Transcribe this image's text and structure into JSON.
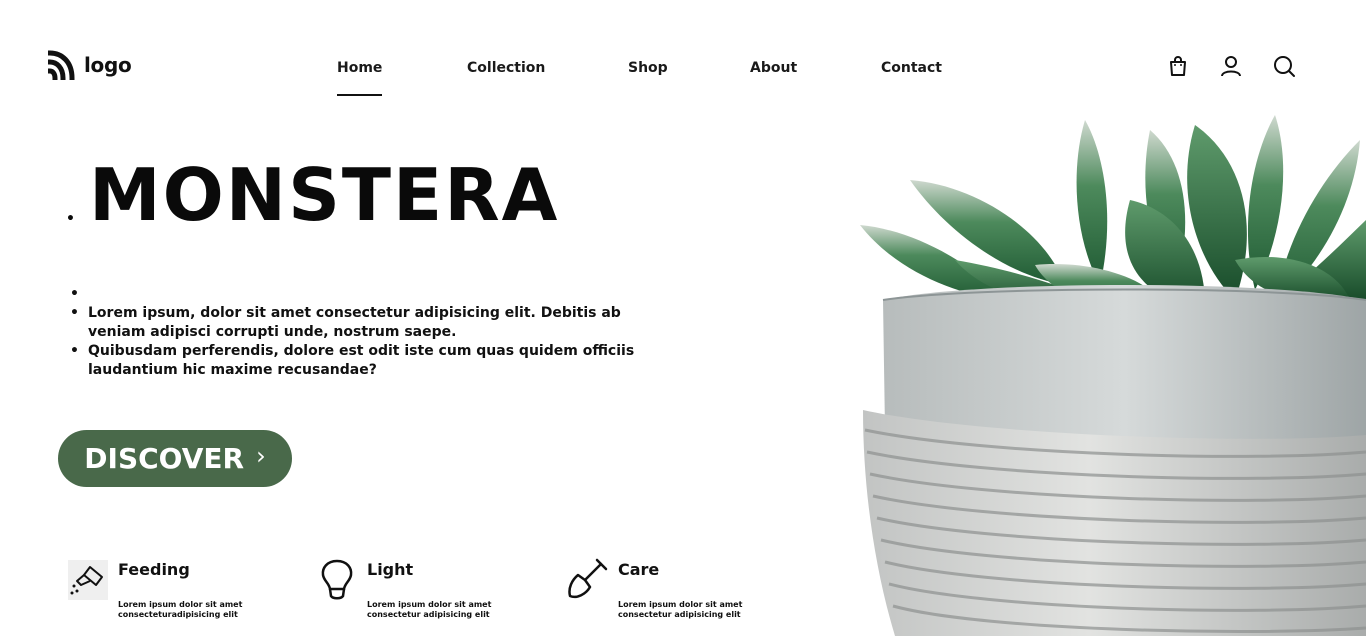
{
  "brand": {
    "logo_text": "logo"
  },
  "nav": {
    "items": [
      {
        "label": "Home",
        "active": true
      },
      {
        "label": "Collection"
      },
      {
        "label": "Shop"
      },
      {
        "label": "About"
      },
      {
        "label": "Contact"
      }
    ]
  },
  "header_icons": [
    "shopping-bag-icon",
    "user-icon",
    "search-icon"
  ],
  "hero": {
    "title": "MONSTERA",
    "bullets": [
      "",
      "Lorem ipsum, dolor sit amet consectetur adipisicing elit. Debitis ab veniam adipisci corrupti unde, nostrum saepe.",
      "Quibusdam perferendis, dolore est odit iste cum quas quidem officiis laudantium hic maxime recusandae?"
    ],
    "cta_label": "DISCOVER",
    "cta_color": "#49694a"
  },
  "features": [
    {
      "title": "Feeding",
      "text": "Lorem ipsum dolor sit amet consecteturadipisicing elit",
      "icon": "watering-can-icon"
    },
    {
      "title": "Light",
      "text": "Lorem ipsum dolor sit amet consectetur adipisicing elit",
      "icon": "lightbulb-icon"
    },
    {
      "title": "Care",
      "text": "Lorem ipsum dolor sit amet consectetur adipisicing elit",
      "icon": "shovel-icon"
    }
  ]
}
